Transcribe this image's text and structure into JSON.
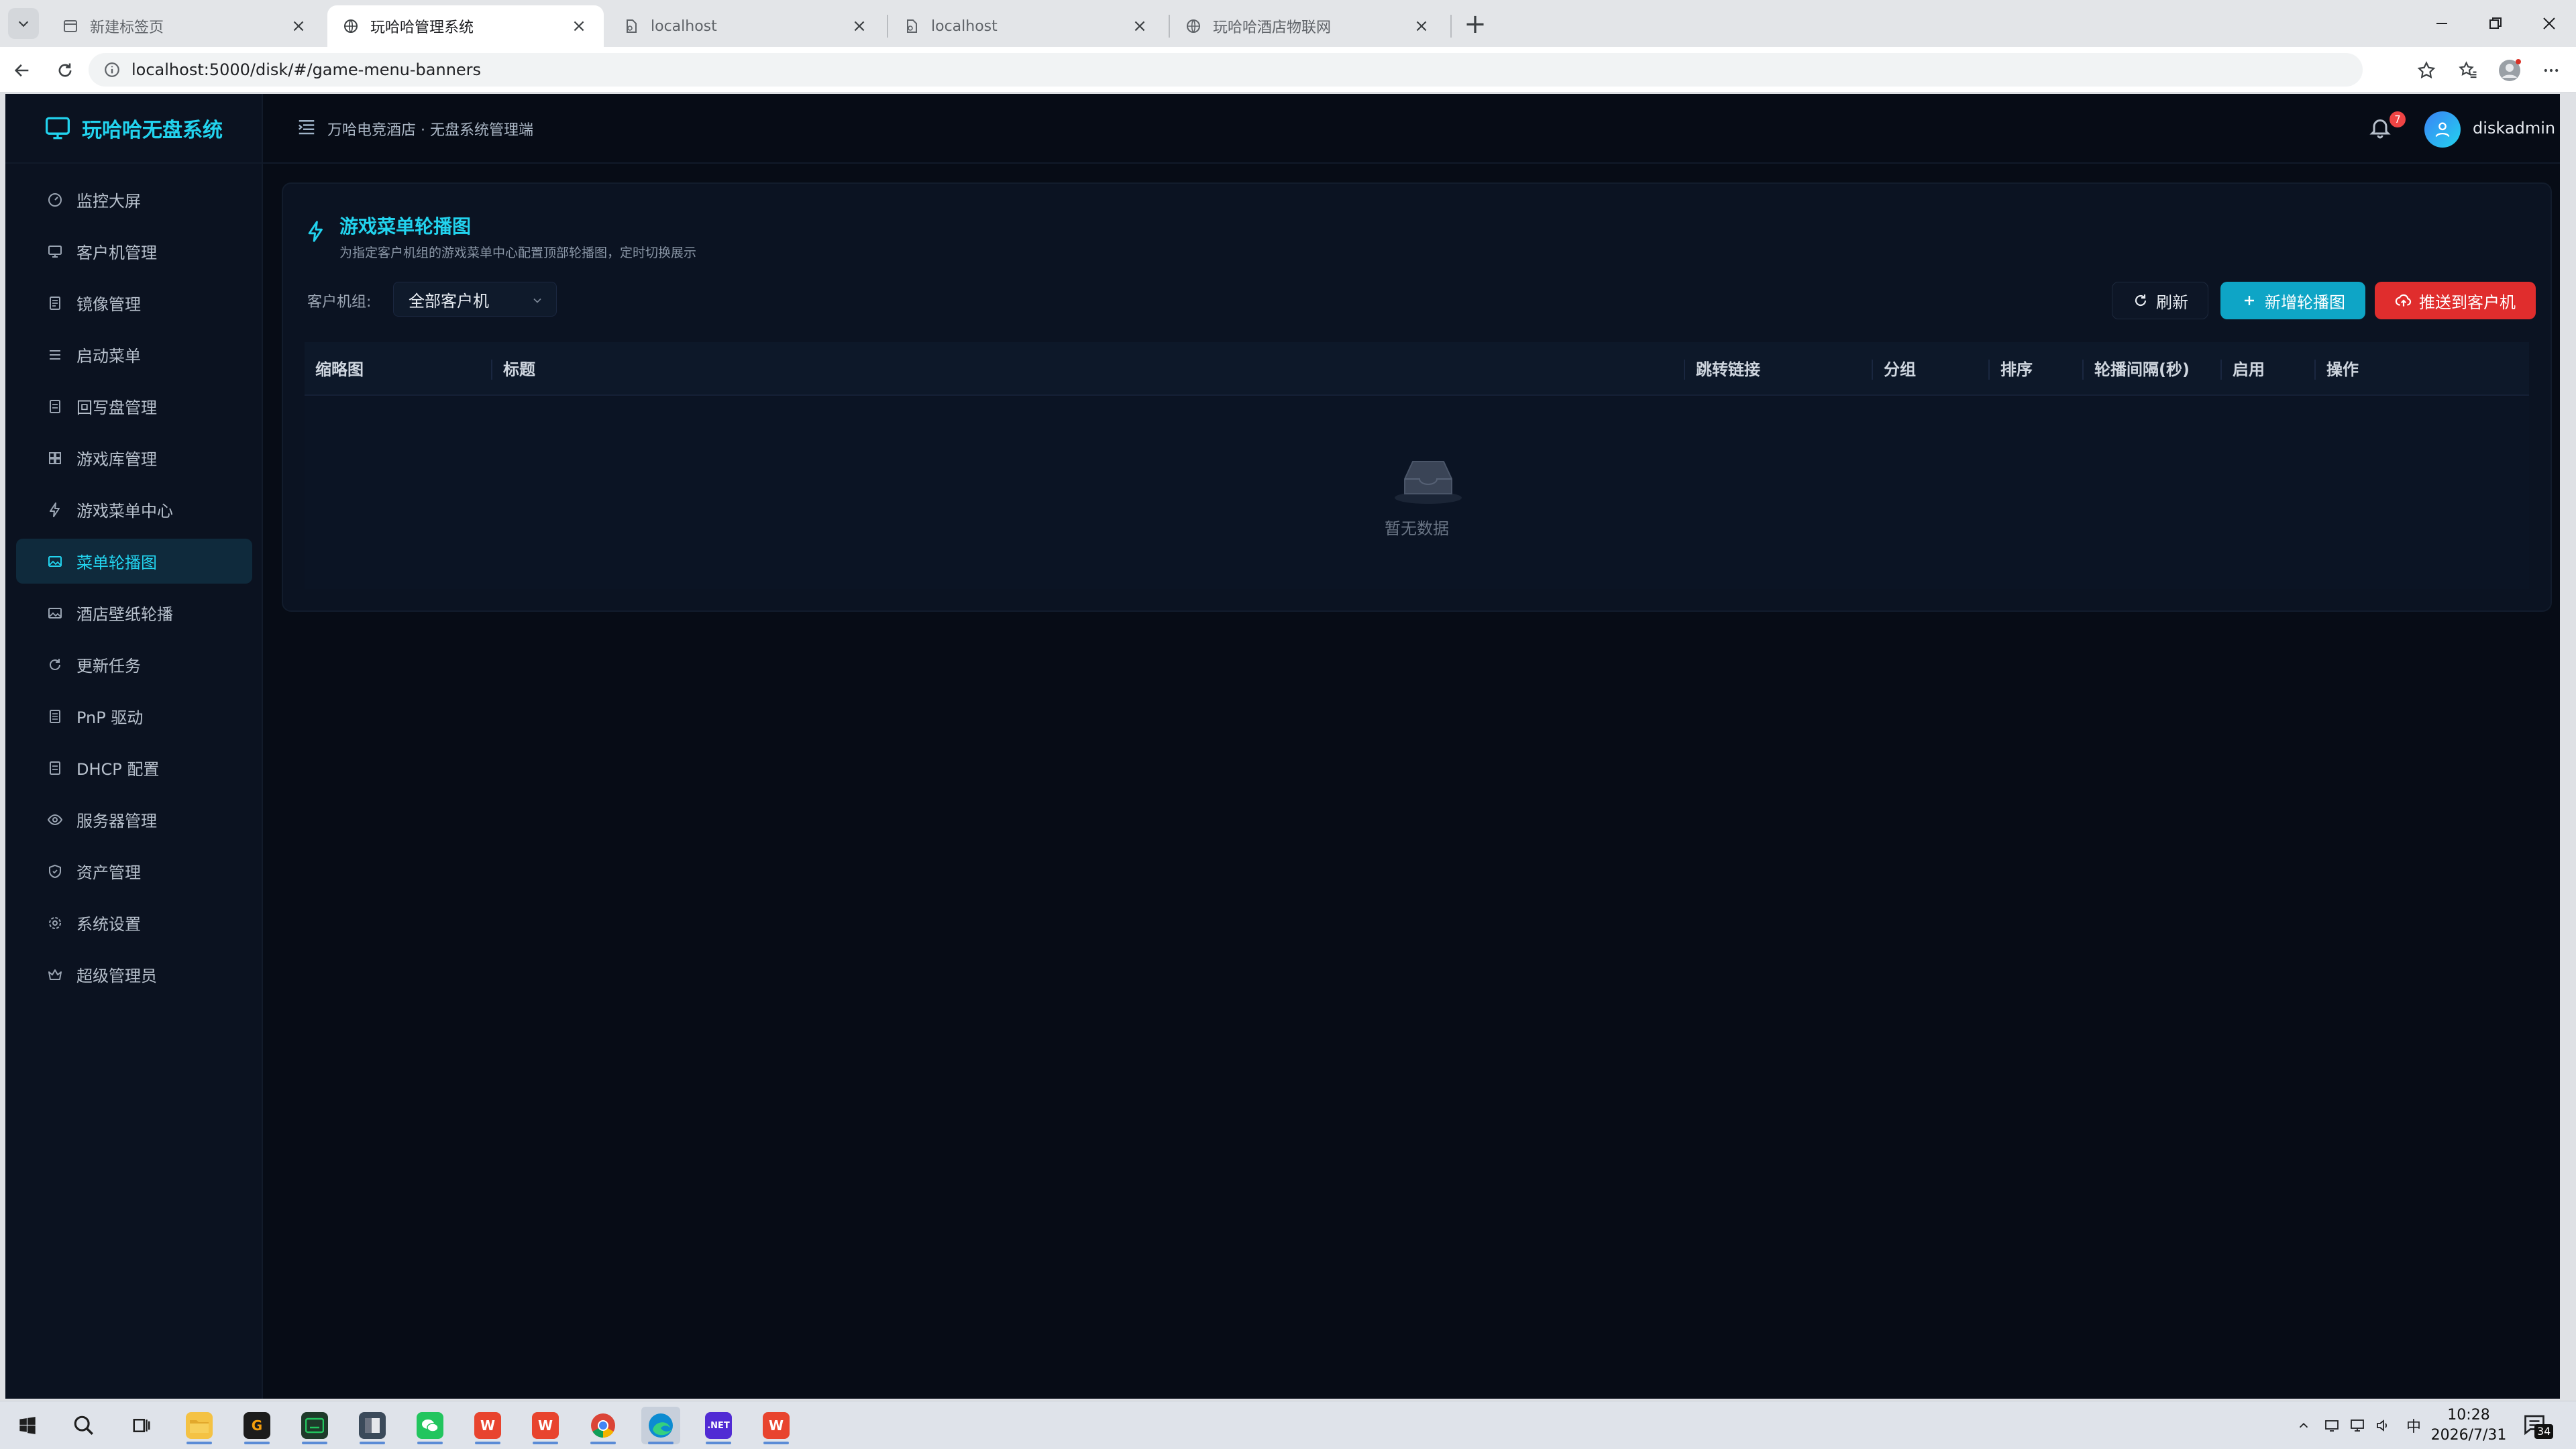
{
  "browser": {
    "tabs": [
      {
        "title": "新建标签页",
        "icon": "new-tab-page-icon"
      },
      {
        "title": "玩哈哈管理系统",
        "icon": "globe-icon"
      },
      {
        "title": "localhost",
        "icon": "page-icon"
      },
      {
        "title": "localhost",
        "icon": "page-icon"
      },
      {
        "title": "玩哈哈酒店物联网",
        "icon": "globe-icon"
      }
    ],
    "active_tab": 1,
    "tab_close_glyph": "×",
    "new_tab_glyph": "+",
    "url": "localhost:5000/disk/#/game-menu-banners"
  },
  "app": {
    "logo_text": "玩哈哈无盘系统",
    "accent_color": "#22d3ee",
    "sidebar": {
      "items": [
        {
          "label": "监控大屏",
          "icon": "dashboard-icon"
        },
        {
          "label": "客户机管理",
          "icon": "monitor-icon"
        },
        {
          "label": "镜像管理",
          "icon": "disk-image-icon"
        },
        {
          "label": "启动菜单",
          "icon": "list-icon"
        },
        {
          "label": "回写盘管理",
          "icon": "disk-icon"
        },
        {
          "label": "游戏库管理",
          "icon": "grid-icon"
        },
        {
          "label": "游戏菜单中心",
          "icon": "lightning-icon"
        },
        {
          "label": "菜单轮播图",
          "icon": "image-icon",
          "active": true
        },
        {
          "label": "酒店壁纸轮播",
          "icon": "image-icon"
        },
        {
          "label": "更新任务",
          "icon": "refresh-icon"
        },
        {
          "label": "PnP 驱动",
          "icon": "chip-icon"
        },
        {
          "label": "DHCP 配置",
          "icon": "server-icon"
        },
        {
          "label": "服务器管理",
          "icon": "eye-icon"
        },
        {
          "label": "资产管理",
          "icon": "shield-icon"
        },
        {
          "label": "系统设置",
          "icon": "gear-icon"
        },
        {
          "label": "超级管理员",
          "icon": "crown-icon"
        }
      ]
    },
    "header": {
      "breadcrumb": "万哈电竞酒店 · 无盘系统管理端",
      "notification_count": "7",
      "username": "diskadmin"
    },
    "page": {
      "title": "游戏菜单轮播图",
      "subtitle": "为指定客户机组的游戏菜单中心配置顶部轮播图，定时切换展示",
      "filter_label": "客户机组:",
      "filter_value": "全部客户机",
      "buttons": {
        "refresh": "刷新",
        "add": "新增轮播图",
        "push": "推送到客户机"
      },
      "button_colors": {
        "add": "#0ea5c6",
        "push": "#e02d2d"
      },
      "table": {
        "columns": [
          "缩略图",
          "标题",
          "跳转链接",
          "分组",
          "排序",
          "轮播间隔(秒)",
          "启用",
          "操作"
        ],
        "rows": [],
        "empty_text": "暂无数据"
      }
    }
  },
  "taskbar": {
    "tray_ime": "中",
    "time": "10:28",
    "date": "2026/7/31",
    "notification_badge": "34"
  }
}
